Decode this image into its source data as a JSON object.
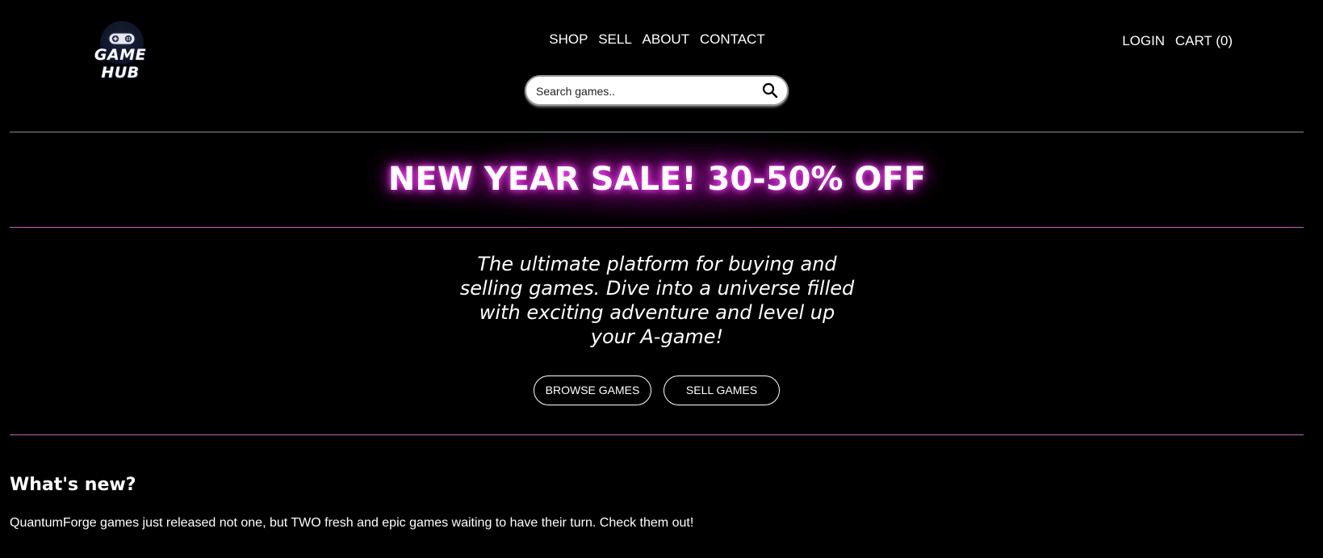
{
  "logo": {
    "text": "GAME HUB"
  },
  "nav": {
    "items": [
      "SHOP",
      "SELL",
      "ABOUT",
      "CONTACT"
    ]
  },
  "user_nav": {
    "login": "LOGIN",
    "cart": "CART (0)"
  },
  "search": {
    "placeholder": "Search games..",
    "icon": "search-icon"
  },
  "hero": {
    "sale_banner": "NEW YEAR SALE! 30-50% OFF",
    "tagline": "The ultimate platform for buying and selling games. Dive into a universe filled with exciting adventure and level up your A-game!",
    "browse_button": "BROWSE GAMES",
    "sell_button": "SELL GAMES"
  },
  "whats_new": {
    "heading": "What's new?",
    "text": "QuantumForge games just released not one, but TWO fresh and epic games waiting to have their turn. Check them out!"
  },
  "colors": {
    "background": "#000000",
    "accent_divider": "#c25fc2",
    "glow": "#ff4dff"
  }
}
